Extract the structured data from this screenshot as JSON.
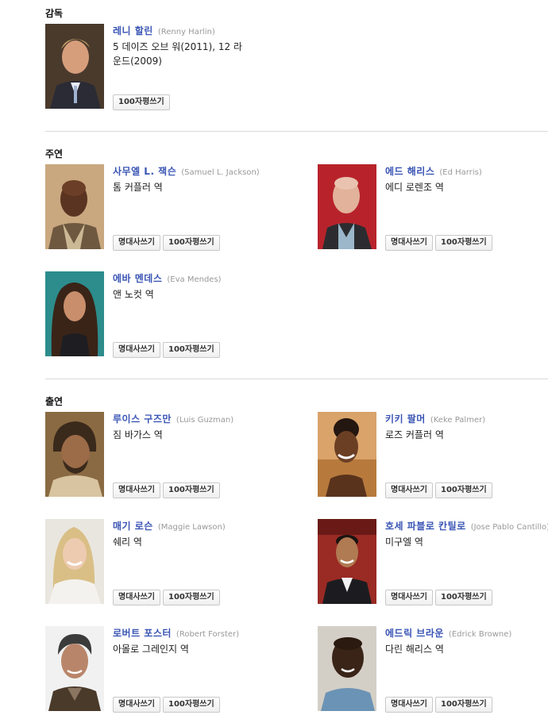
{
  "sections": {
    "director": "감독",
    "lead": "주연",
    "cast": "출연"
  },
  "buttons": {
    "quote": "명대사쓰기",
    "review": "100자평쓰기"
  },
  "people": {
    "renny": {
      "name": "레니 할린",
      "eng": "(Renny Harlin)",
      "role": "5 데이즈 오브 워(2011), 12 라운드(2009)"
    },
    "samuel": {
      "name": "사무엘 L. 잭슨",
      "eng": "(Samuel L. Jackson)",
      "role": "톰 커플러 역"
    },
    "ed": {
      "name": "에드 해리스",
      "eng": "(Ed Harris)",
      "role": "에디 로렌조 역"
    },
    "eva": {
      "name": "에바 멘데스",
      "eng": "(Eva Mendes)",
      "role": "앤 노컷 역"
    },
    "luis": {
      "name": "루이스 구즈만",
      "eng": "(Luis Guzman)",
      "role": "짐 바가스 역"
    },
    "keke": {
      "name": "키키 팔머",
      "eng": "(Keke Palmer)",
      "role": "로즈 커플러 역"
    },
    "maggie": {
      "name": "매기 로슨",
      "eng": "(Maggie Lawson)",
      "role": "쉐리 역"
    },
    "jose": {
      "name": "호세 파블로 칸틸로",
      "eng": "(Jose Pablo Cantillo)",
      "role": "미구엘 역"
    },
    "robert": {
      "name": "로버트 포스터",
      "eng": "(Robert Forster)",
      "role": "아몰로 그레인지 역"
    },
    "edrick": {
      "name": "에드릭 브라운",
      "eng": "(Edrick Browne)",
      "role": "다린 해리스 역"
    }
  }
}
